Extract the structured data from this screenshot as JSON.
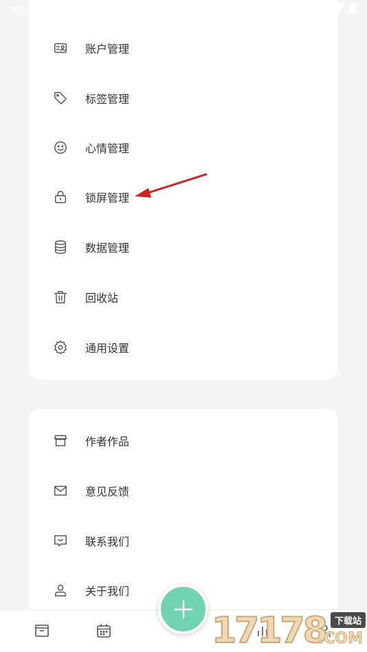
{
  "status_bar": {
    "time": "9:04",
    "icons": [
      "sync-icon",
      "sync-icon",
      "clipboard-icon"
    ],
    "right_icons": [
      "wifi-icon",
      "battery-icon"
    ]
  },
  "menu_group_1": [
    {
      "label": "账户管理",
      "icon": "account-card-icon"
    },
    {
      "label": "标签管理",
      "icon": "tag-icon"
    },
    {
      "label": "心情管理",
      "icon": "smile-icon"
    },
    {
      "label": "锁屏管理",
      "icon": "lock-icon"
    },
    {
      "label": "数据管理",
      "icon": "database-icon"
    },
    {
      "label": "回收站",
      "icon": "trash-icon"
    },
    {
      "label": "通用设置",
      "icon": "gear-icon"
    }
  ],
  "menu_group_2": [
    {
      "label": "作者作品",
      "icon": "store-icon"
    },
    {
      "label": "意见反馈",
      "icon": "mail-icon"
    },
    {
      "label": "联系我们",
      "icon": "chat-smile-icon"
    },
    {
      "label": "关于我们",
      "icon": "user-icon"
    }
  ],
  "annotation_arrow": {
    "color": "#e02020",
    "points_to": "锁屏管理"
  },
  "bottom_nav": {
    "items": [
      "inbox-icon",
      "calendar-icon",
      "stats-icon",
      "profile-icon"
    ]
  },
  "fab": {
    "icon": "plus-icon",
    "color": "#6fd3b4"
  },
  "watermark": {
    "number": "17178",
    "tag": "下载站",
    "suffix": ".COM"
  }
}
